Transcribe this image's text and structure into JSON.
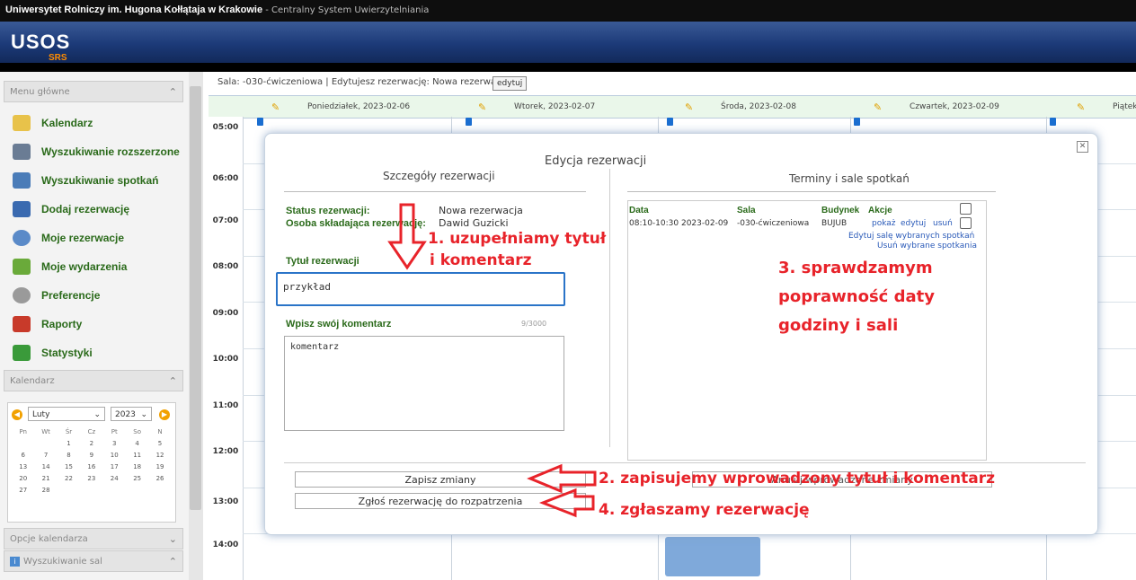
{
  "topbar": {
    "university": "Uniwersytet Rolniczy im. Hugona Kołłątaja w Krakowie",
    "system": " - Centralny System Uwierzytelniania"
  },
  "logo": {
    "name": "USOS",
    "sub": "SRS"
  },
  "sidebar": {
    "menu_header": "Menu główne",
    "items": [
      {
        "label": "Kalendarz",
        "icon": "calendar-icon",
        "color": "#e8c24a"
      },
      {
        "label": "Wyszukiwanie rozszerzone",
        "icon": "books-search-icon",
        "color": "#6a7c94"
      },
      {
        "label": "Wyszukiwanie spotkań",
        "icon": "calendar-search-icon",
        "color": "#4a7cb8"
      },
      {
        "label": "Dodaj rezerwację",
        "icon": "calendar-add-icon",
        "color": "#3a6ab0"
      },
      {
        "label": "Moje rezerwacje",
        "icon": "magnifier-icon",
        "color": "#5a8ac8"
      },
      {
        "label": "Moje wydarzenia",
        "icon": "list-icon",
        "color": "#6aaa3a"
      },
      {
        "label": "Preferencje",
        "icon": "gear-icon",
        "color": "#9a9a9a"
      },
      {
        "label": "Raporty",
        "icon": "pdf-icon",
        "color": "#c83a2a"
      },
      {
        "label": "Statystyki",
        "icon": "bar-chart-icon",
        "color": "#3a9a3a"
      }
    ],
    "calendar_header": "Kalendarz",
    "options_header": "Opcje kalendarza",
    "rooms_header": "Wyszukiwanie sal"
  },
  "minical": {
    "month": "Luty",
    "year": "2023",
    "weekdays": [
      "Pn",
      "Wt",
      "Śr",
      "Cz",
      "Pt",
      "So",
      "N"
    ],
    "weeks": [
      [
        "",
        "",
        "1",
        "2",
        "3",
        "4",
        "5"
      ],
      [
        "6",
        "7",
        "8",
        "9",
        "10",
        "11",
        "12"
      ],
      [
        "13",
        "14",
        "15",
        "16",
        "17",
        "18",
        "19"
      ],
      [
        "20",
        "21",
        "22",
        "23",
        "24",
        "25",
        "26"
      ],
      [
        "27",
        "28",
        "",
        "",
        "",
        "",
        ""
      ]
    ]
  },
  "main": {
    "breadcrumb": "Sala: -030-ćwiczeniowa | Edytujesz rezerwację: Nowa rezerwacja",
    "edit_label": "edytuj",
    "days": [
      "Poniedziałek, 2023-02-06",
      "Wtorek, 2023-02-07",
      "Środa, 2023-02-08",
      "Czwartek, 2023-02-09",
      "Piątek,"
    ],
    "times": [
      "05:00",
      "06:00",
      "07:00",
      "08:00",
      "09:00",
      "10:00",
      "11:00",
      "12:00",
      "13:00",
      "14:00"
    ]
  },
  "dialog": {
    "title": "Edycja rezerwacji",
    "left_header": "Szczegóły rezerwacji",
    "right_header": "Terminy i sale spotkań",
    "status_label": "Status rezerwacji:",
    "status_value": "Nowa rezerwacja",
    "person_label": "Osoba składająca rezerwację:",
    "person_value": "Dawid Guzicki",
    "title_label": "Tytuł rezerwacji",
    "title_value": "przykład",
    "comment_label": "Wpisz swój komentarz",
    "comment_counter": "9/3000",
    "comment_value": "komentarz",
    "table": {
      "headers": [
        "Data",
        "Sala",
        "Budynek",
        "Akcje"
      ],
      "row": {
        "date": "08:10-10:30 2023-02-09",
        "room": "-030-ćwiczeniowa",
        "building": "BUJUB",
        "show": "pokaż",
        "edit": "edytuj",
        "delete": "usuń"
      },
      "edit_selected": "Edytuj salę wybranych spotkań",
      "delete_selected": "Usuń wybrane spotkania"
    },
    "save_button": "Zapisz zmiany",
    "submit_button": "Zgłoś rezerwację do rozpatrzenia",
    "hidden_button": "Anuluj wprowadzone zmiany"
  },
  "annotations": {
    "step1_line1": "1. uzupełniamy tytuł",
    "step1_line2": "i komentarz",
    "step2": "2. zapisujemy wprowadzony tytuł i komentarz",
    "step3_line1": "3. sprawdzamym",
    "step3_line2": "poprawność daty",
    "step3_line3": "godziny i sali",
    "step4": "4. zgłaszamy rezerwację",
    "color": "#e8232a"
  }
}
